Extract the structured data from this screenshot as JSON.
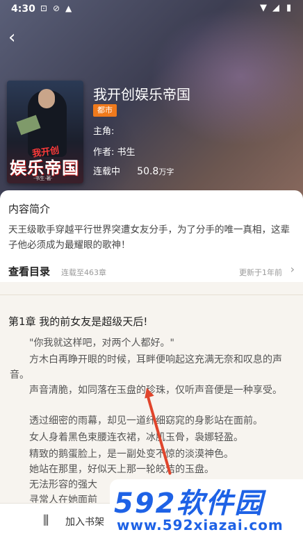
{
  "status_bar": {
    "time": "4:30",
    "icons": [
      "alert-a-icon",
      "blocked-icon",
      "notification-icon"
    ],
    "right_icons": [
      "wifi-icon",
      "signal-icon",
      "battery-icon"
    ]
  },
  "book": {
    "cover": {
      "small_text": "我开创",
      "big_text": "娱乐帝国",
      "tag_text": "·书生·著·"
    },
    "title": "我开创娱乐帝国",
    "genre": "都市",
    "protagonist_label": "主角:",
    "author_label": "作者:",
    "author_name": "书生",
    "status": "连载中",
    "count_value": "50.8",
    "count_unit": "万字"
  },
  "intro": {
    "section_title": "内容简介",
    "text": "天王级歌手穿越平行世界突遭女友分手，为了分手的唯一真相，这辈子他必须成为最耀眼的歌神！"
  },
  "toc": {
    "title": "查看目录",
    "chapters": "连载至463章",
    "updated": "更新于1年前"
  },
  "reader": {
    "chapter_title": "第1章  我的前女友是超级天后!",
    "paragraphs": [
      "\"你我就这样吧，对两个人都好。\"",
      "方木白再睁开眼的时候，耳畔便响起这充满无奈和叹息的声音。",
      "声音清脆，如同落在玉盘的珍珠，仅听声音便是一种享受。",
      "透过细密的雨幕，却见一道纤细窈窕的身影站在面前。",
      "女人身着黑色束腰连衣裙，冰肌玉骨，袅娜轻盈。",
      "精致的鹅蛋脸上，是一副处变不惊的淡漠神色。",
      "她站在那里，好似天上那一轮皎洁的玉盘。",
      "无法形容的强大",
      "寻常人在她面前"
    ]
  },
  "bottom_bar": {
    "shelf_label": "加入书架"
  },
  "watermark": {
    "logo": "592软件园",
    "url": "www.592xiazai.com"
  }
}
